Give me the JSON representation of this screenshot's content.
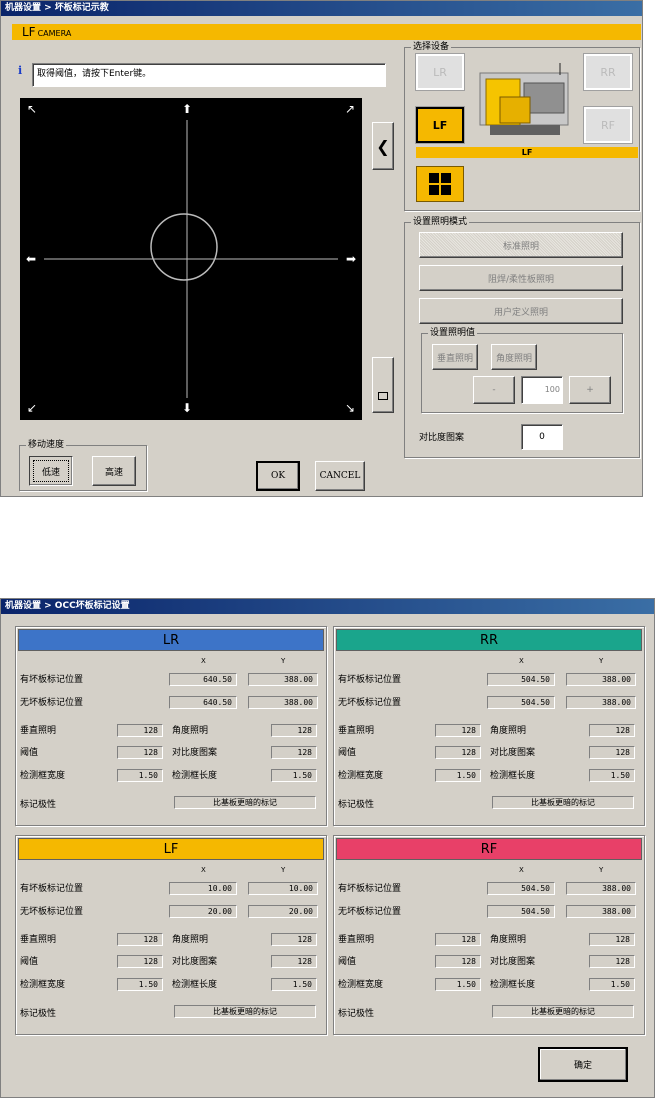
{
  "top": {
    "title": "机器设置 > 坏板标记示教",
    "camera_prefix": "LF",
    "camera_suffix": "CAMERA",
    "info_text": "取得阈值，请按下Enter键。",
    "device_group_label": "选择设备",
    "devices": {
      "lr": "LR",
      "rr": "RR",
      "lf": "LF",
      "rf": "RF",
      "selected_bar": "LF"
    },
    "light_mode_label": "设置照明模式",
    "light_modes": [
      "标准照明",
      "阻焊/柔性板照明",
      "用户定义照明"
    ],
    "light_value_label": "设置照明值",
    "vertical_light": "垂直照明",
    "angle_light": "角度照明",
    "minus": "-",
    "plus": "+",
    "light_value": "100",
    "contrast_label": "对比度图案",
    "contrast_value": "0",
    "speed_label": "移动速度",
    "low_speed": "低速",
    "high_speed": "高速",
    "ok": "OK",
    "cancel": "CANCEL",
    "accent": "#f5b800"
  },
  "bottom": {
    "title": "机器设置 > OCC坏板标记设置",
    "x_label": "X",
    "y_label": "Y",
    "row_labels": {
      "bad_pos": "有坏板标记位置",
      "nobad_pos": "无坏板标记位置",
      "vertical": "垂直照明",
      "angle": "角度照明",
      "threshold": "阈值",
      "contrast": "对比度图案",
      "box_width": "检测框宽度",
      "box_length": "检测框长度",
      "polarity": "标记极性"
    },
    "panels": {
      "lr": {
        "name": "LR",
        "color": "#3d74c8",
        "bad_x": "640.50",
        "bad_y": "388.00",
        "nobad_x": "640.50",
        "nobad_y": "388.00",
        "vertical": "128",
        "angle": "128",
        "threshold": "128",
        "contrast": "128",
        "box_width": "1.50",
        "box_length": "1.50",
        "polarity": "比基板更暗的标记"
      },
      "rr": {
        "name": "RR",
        "color": "#1aa58c",
        "bad_x": "504.50",
        "bad_y": "388.00",
        "nobad_x": "504.50",
        "nobad_y": "388.00",
        "vertical": "128",
        "angle": "128",
        "threshold": "128",
        "contrast": "128",
        "box_width": "1.50",
        "box_length": "1.50",
        "polarity": "比基板更暗的标记"
      },
      "lf": {
        "name": "LF",
        "color": "#f5b800",
        "bad_x": "10.00",
        "bad_y": "10.00",
        "nobad_x": "20.00",
        "nobad_y": "20.00",
        "vertical": "128",
        "angle": "128",
        "threshold": "128",
        "contrast": "128",
        "box_width": "1.50",
        "box_length": "1.50",
        "polarity": "比基板更暗的标记"
      },
      "rf": {
        "name": "RF",
        "color": "#e84068",
        "bad_x": "504.50",
        "bad_y": "388.00",
        "nobad_x": "504.50",
        "nobad_y": "388.00",
        "vertical": "128",
        "angle": "128",
        "threshold": "128",
        "contrast": "128",
        "box_width": "1.50",
        "box_length": "1.50",
        "polarity": "比基板更暗的标记"
      }
    },
    "confirm": "确定"
  }
}
